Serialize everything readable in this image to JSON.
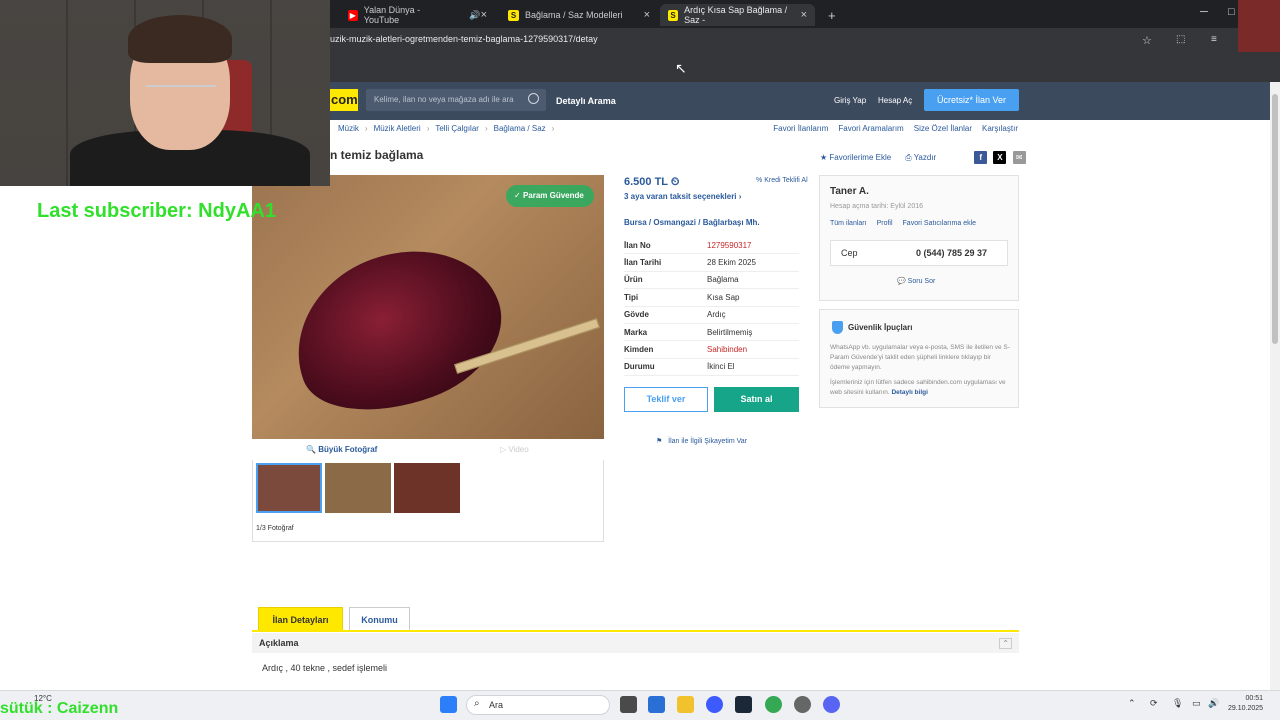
{
  "browser": {
    "tabs": [
      {
        "label": "Yalan Dünya - YouTube",
        "favicon": "youtube-icon"
      },
      {
        "label": "Bağlama / Saz Modelleri",
        "favicon": "sahibinden-icon"
      },
      {
        "label": "Ardıç Kısa Sap Bağlama / Saz -",
        "favicon": "sahibinden-icon"
      }
    ],
    "new_tab": "+",
    "url": "uzik-muzik-aletleri-ogretmenden-temiz-baglama-1279590317/detay"
  },
  "site": {
    "logo_text": "com",
    "search_placeholder": "Kelime, ilan no veya mağaza adı ile ara",
    "detailed_search": "Detaylı Arama",
    "login": "Giriş Yap",
    "register": "Hesap Aç",
    "cta": "Ücretsiz* İlan Ver",
    "accent": "#ffe800",
    "header_bg": "#3c4a5e"
  },
  "breadcrumbs": [
    "Müzik",
    "Müzik Aletleri",
    "Telli Çalgılar",
    "Bağlama / Saz"
  ],
  "top_links": [
    "Favori İlanlarım",
    "Favori Aramalarım",
    "Size Özel İlanlar",
    "Karşılaştır"
  ],
  "listing": {
    "title": "n temiz bağlama",
    "favorite": "Favorilerime Ekle",
    "print": "Yazdır",
    "param_badge": "Param Güvende",
    "big_photo": "Büyük Fotoğraf",
    "video": "Video",
    "photo_count": "1/3 Fotoğraf",
    "price": "6.500 TL",
    "credit": "Kredi Teklifi Al",
    "installment": "3 aya varan taksit seçenekleri",
    "location": "Bursa  /  Osmangazi  /  Bağlarbaşı Mh.",
    "details": [
      {
        "k": "İlan No",
        "v": "1279590317"
      },
      {
        "k": "İlan Tarihi",
        "v": "28 Ekim 2025"
      },
      {
        "k": "Ürün",
        "v": "Bağlama"
      },
      {
        "k": "Tipi",
        "v": "Kısa Sap"
      },
      {
        "k": "Gövde",
        "v": "Ardıç"
      },
      {
        "k": "Marka",
        "v": "Belirtilmemiş"
      },
      {
        "k": "Kimden",
        "v": "Sahibinden"
      },
      {
        "k": "Durumu",
        "v": "İkinci El"
      }
    ],
    "offer_btn": "Teklif ver",
    "buy_btn": "Satın al",
    "complaint": "İlan ile İlgili Şikayetim Var"
  },
  "seller": {
    "name": "Taner A.",
    "since": "Hesap açma tarihi: Eylül 2016",
    "links": [
      "Tüm ilanları",
      "Profil",
      "Favori Satıcılarıma ekle"
    ],
    "phone_label": "Cep",
    "phone": "0 (544) 785 29 37",
    "ask": "Soru Sor"
  },
  "safety": {
    "title": "Güvenlik İpuçları",
    "text1": "WhatsApp vb. uygulamalar veya e-posta, SMS ile iletilen ve S-Param Güvende'yi taklit eden şüpheli linklere tıklayıp bir ödeme yapmayın.",
    "text2": "İşlemleriniz için lütfen sadece sahibinden.com uygulaması ve web sitesini kullanın.",
    "link": "Detaylı bilgi"
  },
  "tabs_lower": {
    "details": "İlan Detayları",
    "location": "Konumu",
    "description_title": "Açıklama",
    "description": "Ardıç , 40 tekne , sedef işlemeli"
  },
  "overlay": {
    "subscriber": "Last subscriber: NdyAA1",
    "bottom": "sütük : Caizenn"
  },
  "taskbar": {
    "weather": "12°C",
    "search": "Ara",
    "time": "00:51",
    "date": "29.10.2025"
  }
}
